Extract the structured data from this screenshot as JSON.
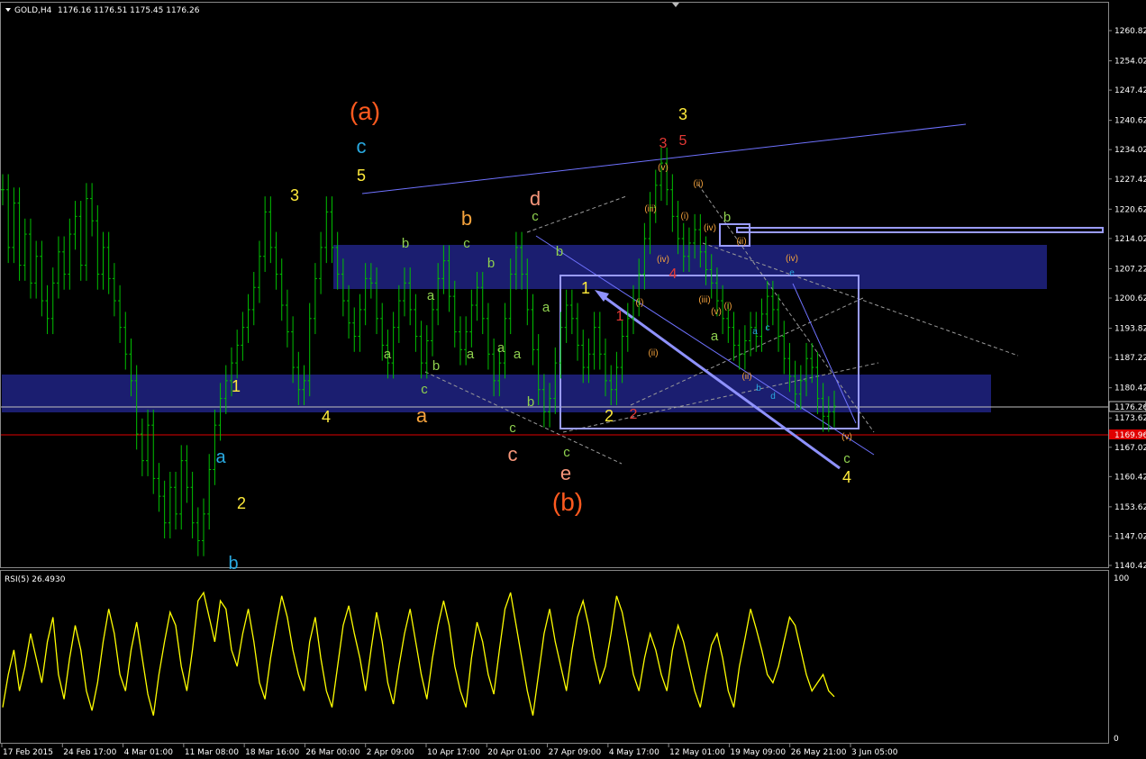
{
  "header": {
    "symbol_label": "GOLD,H4",
    "ohlc": "1176.16 1176.51 1175.45 1176.26"
  },
  "rsi_header": "RSI(5) 26.4930",
  "price_axis": {
    "ticks": [
      "1260.82",
      "1254.02",
      "1247.42",
      "1240.62",
      "1234.02",
      "1227.42",
      "1220.62",
      "1214.02",
      "1207.22",
      "1200.62",
      "1193.82",
      "1187.22",
      "1180.42",
      "1173.62",
      "1167.02",
      "1160.42",
      "1153.62",
      "1147.02",
      "1140.42"
    ],
    "current_price": "1176.26",
    "red_line_price": "1169.96"
  },
  "rsi_axis": {
    "top": "100",
    "bottom": "0"
  },
  "time_axis": [
    "17 Feb 2015",
    "24 Feb 17:00",
    "4 Mar 01:00",
    "11 Mar 08:00",
    "18 Mar 16:00",
    "26 Mar 00:00",
    "2 Apr 09:00",
    "10 Apr 17:00",
    "20 Apr 01:00",
    "27 Apr 09:00",
    "4 May 17:00",
    "12 May 01:00",
    "19 May 09:00",
    "26 May 21:00",
    "3 Jun 05:00"
  ],
  "colors": {
    "background": "#000000",
    "candle": "#00c000",
    "rsi": "#ffff00",
    "zone": "#1b1e70",
    "box": "#9a9cff",
    "current_line": "#c0c0c0",
    "red_line": "#e00000"
  },
  "wave_labels": [
    {
      "text": "(a)",
      "color": "#ff5a1f"
    },
    {
      "text": "c",
      "color": "#29a9e0"
    },
    {
      "text": "5",
      "color": "#ffeb3b"
    },
    {
      "text": "3",
      "color": "#ffeb3b"
    },
    {
      "text": "1",
      "color": "#ffeb3b"
    },
    {
      "text": "2",
      "color": "#ffeb3b"
    },
    {
      "text": "4",
      "color": "#ffeb3b"
    },
    {
      "text": "a",
      "color": "#29a9e0"
    },
    {
      "text": "b",
      "color": "#29a9e0"
    },
    {
      "text": "b",
      "color": "#8fd14f"
    },
    {
      "text": "c",
      "color": "#8fd14f"
    },
    {
      "text": "b",
      "color": "#f4a23c"
    },
    {
      "text": "a",
      "color": "#8fd14f"
    },
    {
      "text": "b",
      "color": "#8fd14f"
    },
    {
      "text": "a",
      "color": "#8fd14f"
    },
    {
      "text": "a",
      "color": "#8fd14f"
    },
    {
      "text": "c",
      "color": "#8fd14f"
    },
    {
      "text": "b",
      "color": "#8fd14f"
    },
    {
      "text": "a",
      "color": "#f4a23c"
    },
    {
      "text": "a",
      "color": "#8fd14f"
    },
    {
      "text": "d",
      "color": "#f7967a"
    },
    {
      "text": "c",
      "color": "#8fd14f"
    },
    {
      "text": "b",
      "color": "#8fd14f"
    },
    {
      "text": "a",
      "color": "#8fd14f"
    },
    {
      "text": "a",
      "color": "#8fd14f"
    },
    {
      "text": "c",
      "color": "#8fd14f"
    },
    {
      "text": "b",
      "color": "#8fd14f"
    },
    {
      "text": "c",
      "color": "#f7967a"
    },
    {
      "text": "c",
      "color": "#8fd14f"
    },
    {
      "text": "e",
      "color": "#f7967a"
    },
    {
      "text": "(b)",
      "color": "#ff5a1f"
    },
    {
      "text": "1",
      "color": "#ffeb3b"
    },
    {
      "text": "1",
      "color": "#e53935"
    },
    {
      "text": "2",
      "color": "#ffeb3b"
    },
    {
      "text": "2",
      "color": "#e53935"
    },
    {
      "text": "3",
      "color": "#ffeb3b"
    },
    {
      "text": "3",
      "color": "#e53935"
    },
    {
      "text": "5",
      "color": "#e53935"
    },
    {
      "text": "4",
      "color": "#e53935"
    },
    {
      "text": "(v)",
      "color": "#f4a23c"
    },
    {
      "text": "(iii)",
      "color": "#f4a23c"
    },
    {
      "text": "(i)",
      "color": "#f4a23c"
    },
    {
      "text": "(ii)",
      "color": "#f4a23c"
    },
    {
      "text": "(iv)",
      "color": "#f4a23c"
    },
    {
      "text": "(i)",
      "color": "#f4a23c"
    },
    {
      "text": "(ii)",
      "color": "#f4a23c"
    },
    {
      "text": "(iii)",
      "color": "#f4a23c"
    },
    {
      "text": "(iv)",
      "color": "#f4a23c"
    },
    {
      "text": "(v)",
      "color": "#f4a23c"
    },
    {
      "text": "(i)",
      "color": "#f4a23c"
    },
    {
      "text": "(ii)",
      "color": "#f4a23c"
    },
    {
      "text": "(ii)",
      "color": "#f4a23c"
    },
    {
      "text": "(iii)",
      "color": "#f4a23c"
    },
    {
      "text": "(iv)",
      "color": "#f4a23c"
    },
    {
      "text": "(v)",
      "color": "#f4a23c"
    },
    {
      "text": "b",
      "color": "#8fd14f"
    },
    {
      "text": "a",
      "color": "#8fd14f"
    },
    {
      "text": "a",
      "color": "#29a9e0"
    },
    {
      "text": "b",
      "color": "#29a9e0"
    },
    {
      "text": "c",
      "color": "#29a9e0"
    },
    {
      "text": "d",
      "color": "#29a9e0"
    },
    {
      "text": "e",
      "color": "#29a9e0"
    },
    {
      "text": "c",
      "color": "#8fd14f"
    },
    {
      "text": "4",
      "color": "#ffeb3b"
    }
  ],
  "chart_data": [
    {
      "type": "candlestick",
      "title": "GOLD,H4",
      "ylim": [
        1140.42,
        1263.5
      ],
      "close_series": [
        1225,
        1212,
        1222,
        1208,
        1215,
        1204,
        1210,
        1200,
        1196,
        1204,
        1211,
        1206,
        1215,
        1219,
        1208,
        1223,
        1218,
        1206,
        1212,
        1205,
        1200,
        1194,
        1188,
        1182,
        1170,
        1164,
        1172,
        1160,
        1156,
        1150,
        1158,
        1152,
        1164,
        1158,
        1150,
        1146,
        1152,
        1162,
        1172,
        1178,
        1182,
        1186,
        1190,
        1194,
        1198,
        1203,
        1210,
        1220,
        1212,
        1206,
        1199,
        1193,
        1185,
        1180,
        1182,
        1196,
        1205,
        1212,
        1220,
        1212,
        1206,
        1200,
        1195,
        1192,
        1198,
        1205,
        1204,
        1196,
        1190,
        1186,
        1194,
        1200,
        1204,
        1198,
        1192,
        1186,
        1191,
        1198,
        1205,
        1209,
        1201,
        1193,
        1189,
        1193,
        1199,
        1203,
        1196,
        1188,
        1182,
        1186,
        1196,
        1206,
        1212,
        1206,
        1198,
        1189,
        1180,
        1175,
        1178,
        1186,
        1194,
        1199,
        1196,
        1190,
        1185,
        1188,
        1194,
        1188,
        1182,
        1180,
        1185,
        1192,
        1196,
        1200,
        1206,
        1214,
        1221,
        1226,
        1231,
        1225,
        1219,
        1214,
        1210,
        1213,
        1216,
        1211,
        1207,
        1204,
        1200,
        1196,
        1194,
        1190,
        1188,
        1191,
        1194,
        1192,
        1197,
        1201,
        1198,
        1192,
        1187,
        1183,
        1179,
        1182,
        1187,
        1185,
        1178,
        1174,
        1175,
        1176.26
      ]
    },
    {
      "type": "line",
      "title": "RSI(5) 26.4930",
      "ylim": [
        0,
        100
      ],
      "values": [
        20,
        40,
        55,
        30,
        45,
        65,
        50,
        35,
        60,
        75,
        40,
        25,
        50,
        70,
        55,
        30,
        18,
        35,
        60,
        80,
        65,
        40,
        30,
        55,
        72,
        50,
        28,
        15,
        40,
        60,
        78,
        70,
        45,
        30,
        55,
        85,
        90,
        75,
        60,
        85,
        80,
        55,
        45,
        65,
        80,
        60,
        35,
        25,
        50,
        70,
        88,
        75,
        55,
        40,
        30,
        60,
        75,
        50,
        30,
        20,
        45,
        70,
        82,
        65,
        50,
        30,
        55,
        78,
        60,
        35,
        22,
        45,
        65,
        80,
        60,
        40,
        25,
        50,
        70,
        85,
        70,
        45,
        30,
        20,
        50,
        72,
        60,
        40,
        28,
        55,
        80,
        90,
        70,
        50,
        30,
        15,
        40,
        65,
        80,
        60,
        45,
        30,
        55,
        75,
        85,
        70,
        50,
        35,
        45,
        65,
        88,
        78,
        60,
        40,
        30,
        50,
        65,
        55,
        40,
        30,
        55,
        70,
        60,
        45,
        30,
        20,
        40,
        58,
        65,
        50,
        30,
        20,
        45,
        62,
        80,
        68,
        55,
        40,
        35,
        45,
        60,
        75,
        70,
        55,
        40,
        30,
        35,
        40,
        30,
        26.493
      ]
    }
  ]
}
